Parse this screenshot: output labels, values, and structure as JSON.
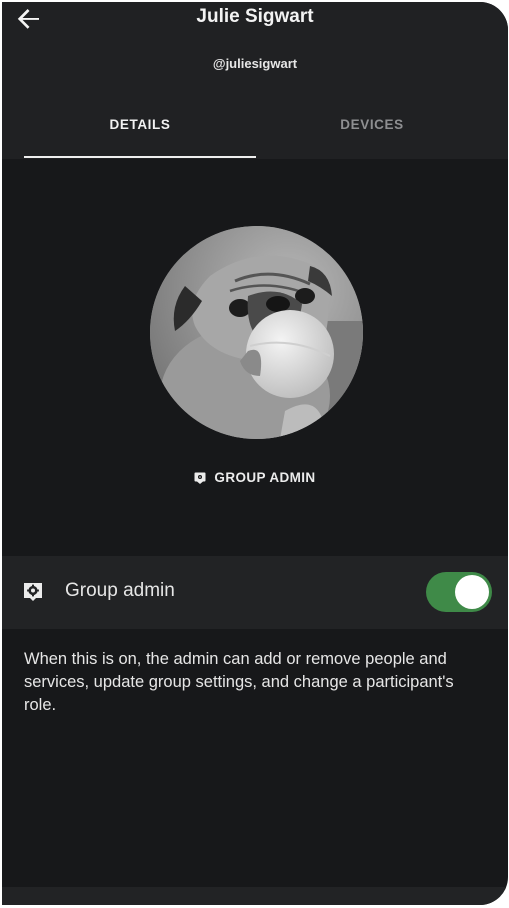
{
  "header": {
    "title": "Julie Sigwart",
    "handle": "@juliesigwart",
    "back_icon": "arrow-left-icon"
  },
  "tabs": [
    {
      "label": "DETAILS",
      "active": true
    },
    {
      "label": "DEVICES",
      "active": false
    }
  ],
  "profile": {
    "avatar_description": "pug-photo",
    "role_icon": "admin-badge-icon",
    "role_label": "GROUP ADMIN"
  },
  "setting": {
    "icon": "admin-settings-icon",
    "label": "Group admin",
    "enabled": true,
    "description": "When this is on, the admin can add or remove people and services, update group settings, and change a participant's role."
  },
  "colors": {
    "background": "#17181a",
    "surface": "#202123",
    "toggle_on": "#3f8a48",
    "text_primary": "#f3f3f3",
    "text_secondary": "#8e8f91"
  }
}
